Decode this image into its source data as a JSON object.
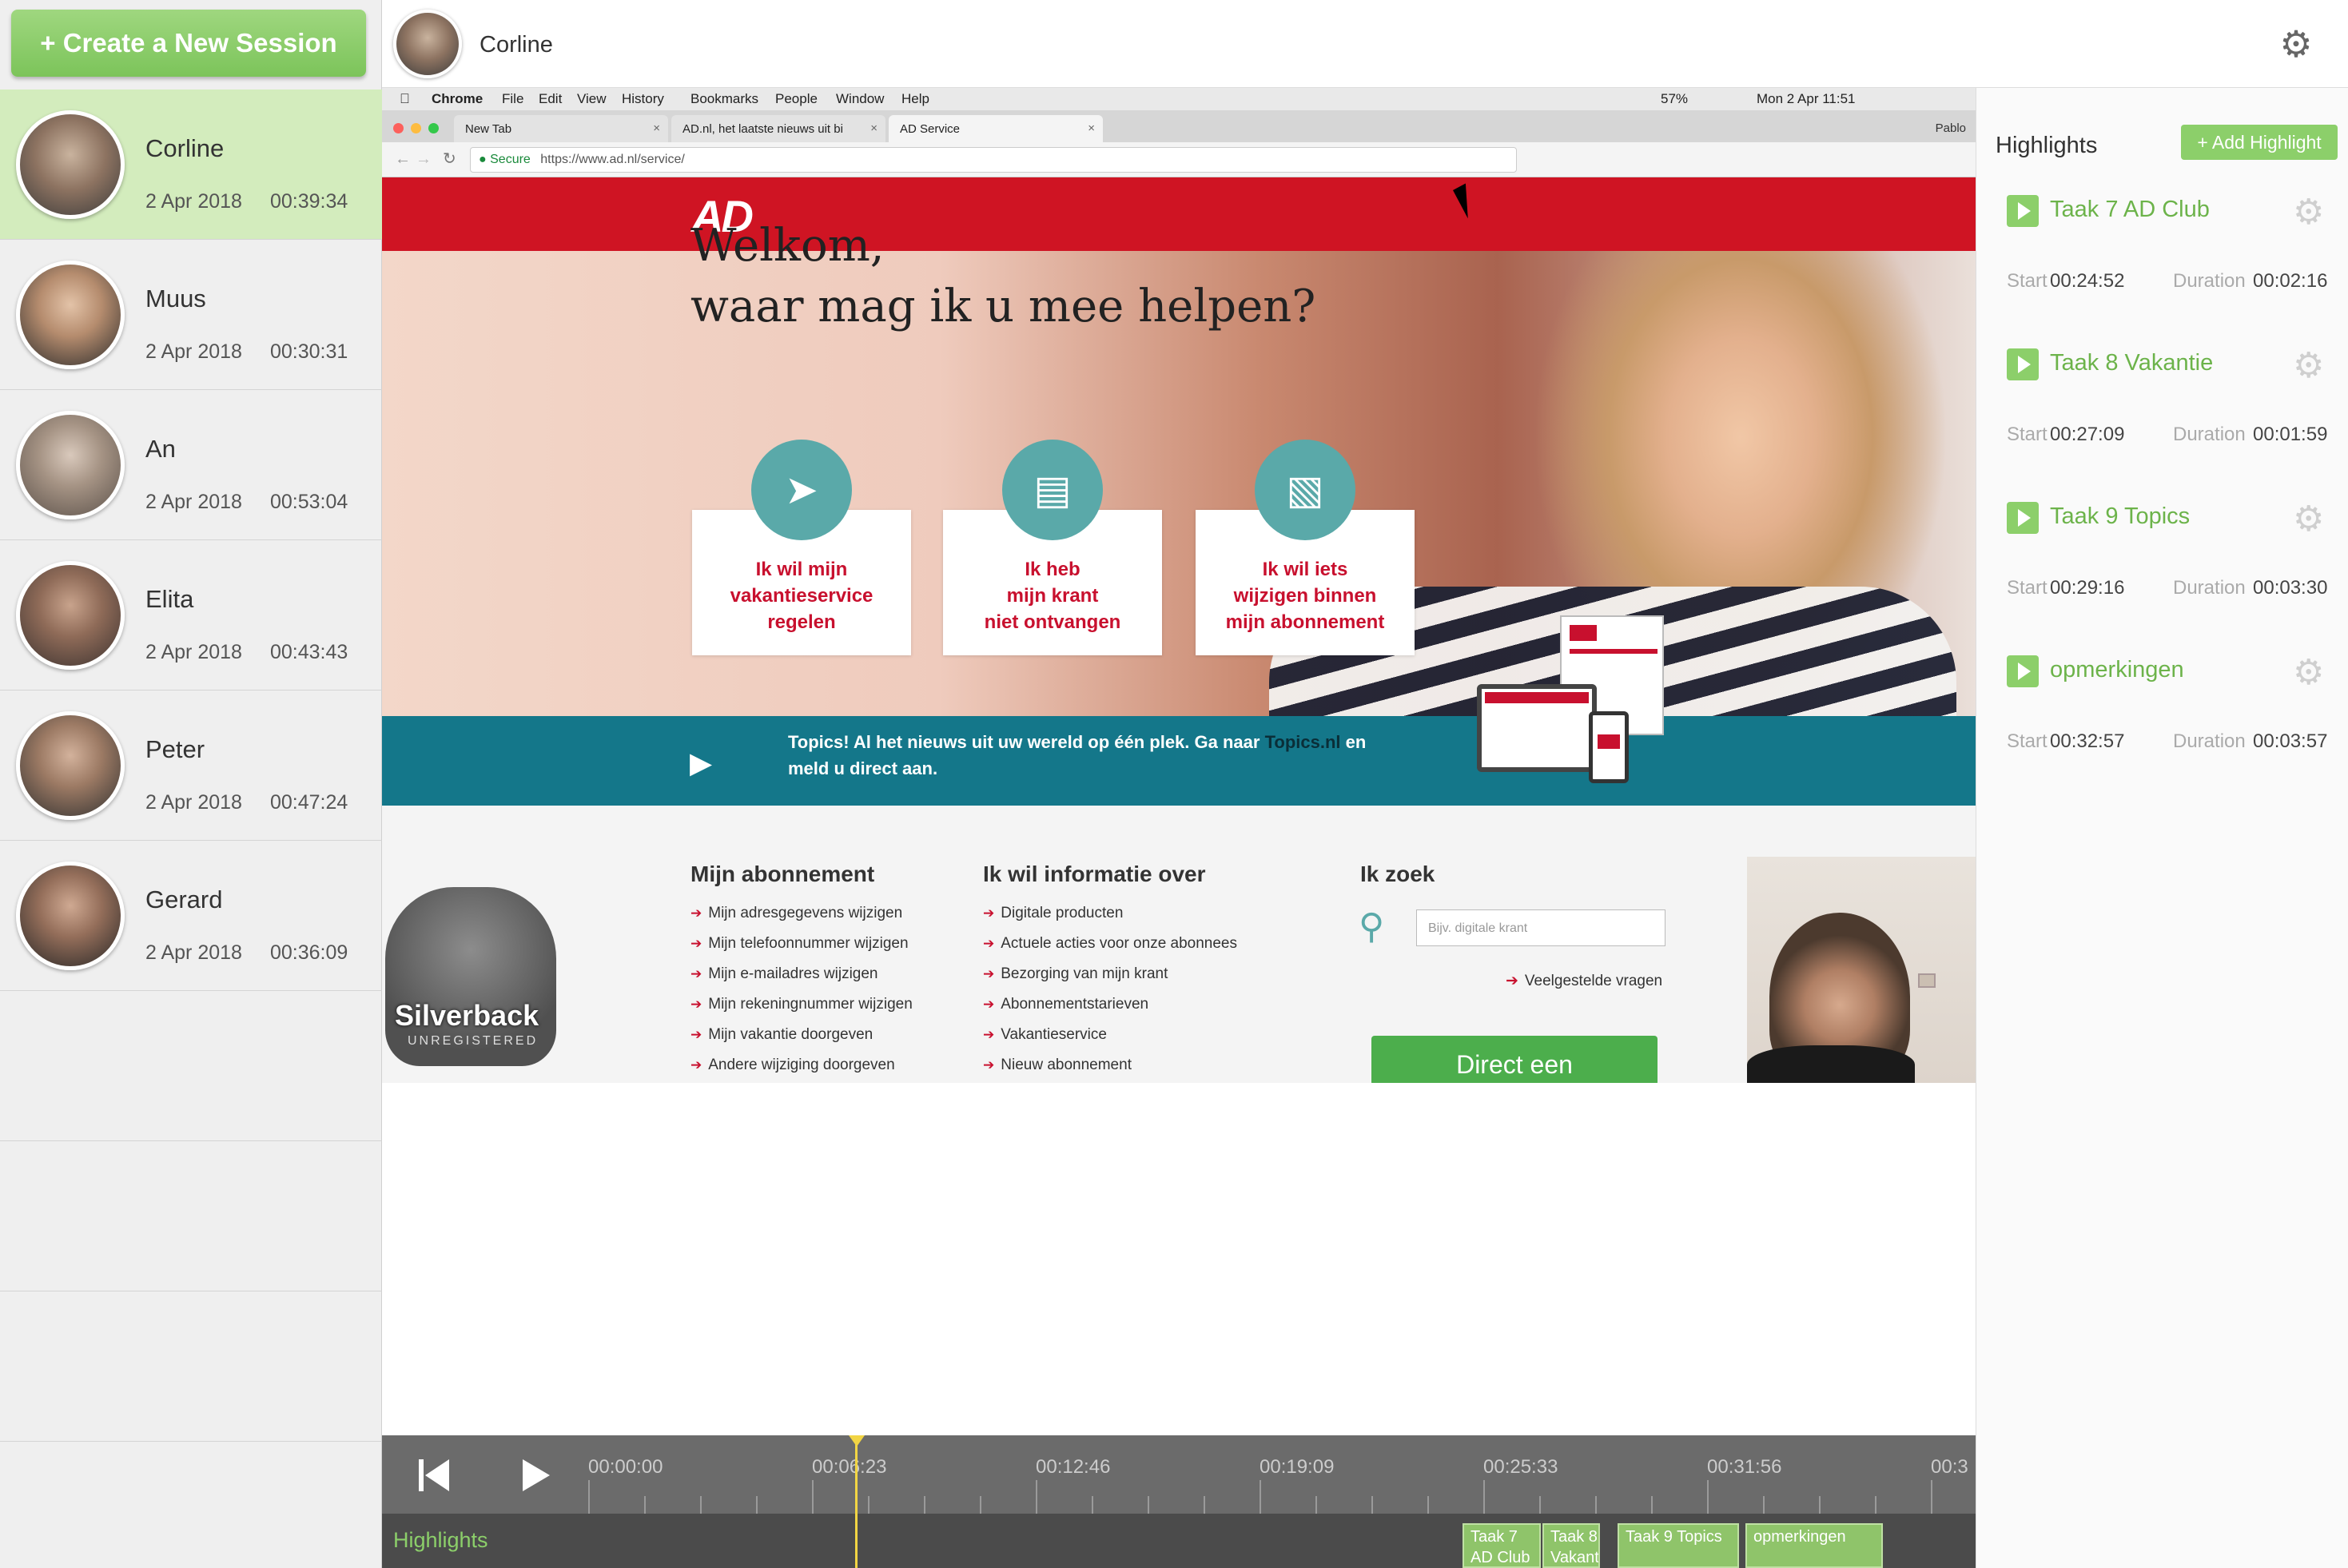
{
  "sidebar": {
    "create_label": "+ Create a New Session",
    "sessions": [
      {
        "name": "Corline",
        "date": "2 Apr 2018",
        "duration": "00:39:34",
        "active": true
      },
      {
        "name": "Muus",
        "date": "2 Apr 2018",
        "duration": "00:30:31"
      },
      {
        "name": "An",
        "date": "2 Apr 2018",
        "duration": "00:53:04"
      },
      {
        "name": "Elita",
        "date": "2 Apr 2018",
        "duration": "00:43:43"
      },
      {
        "name": "Peter",
        "date": "2 Apr 2018",
        "duration": "00:47:24"
      },
      {
        "name": "Gerard",
        "date": "2 Apr 2018",
        "duration": "00:36:09"
      }
    ]
  },
  "header": {
    "session_name": "Corline",
    "settings_icon": "gear-icon"
  },
  "highlights_panel": {
    "title": "Highlights",
    "add_label": "+ Add Highlight",
    "start_label": "Start",
    "duration_label": "Duration",
    "items": [
      {
        "name": "Taak 7 AD Club",
        "start": "00:24:52",
        "duration": "00:02:16"
      },
      {
        "name": "Taak 8 Vakantie",
        "start": "00:27:09",
        "duration": "00:01:59"
      },
      {
        "name": "Taak 9 Topics",
        "start": "00:29:16",
        "duration": "00:03:30"
      },
      {
        "name": "opmerkingen",
        "start": "00:32:57",
        "duration": "00:03:57"
      }
    ]
  },
  "recording": {
    "menubar": {
      "app": "Chrome",
      "menus": [
        "File",
        "Edit",
        "View",
        "History",
        "Bookmarks",
        "People",
        "Window",
        "Help"
      ],
      "battery": "57%",
      "clock": "Mon 2 Apr  11:51"
    },
    "tabs": [
      "New Tab",
      "AD.nl, het laatste nieuws uit bi",
      "AD Service"
    ],
    "profile": "Pablo",
    "secure_label": "Secure",
    "url": "https://www.ad.nl/service/",
    "logo": "AD",
    "welcome_line1": "Welkom,",
    "welcome_line2": "waar mag ik u mee helpen?",
    "cards": [
      {
        "l1": "Ik wil mijn",
        "l2": "vakantieservice",
        "l3": "regelen"
      },
      {
        "l1": "Ik heb",
        "l2": "mijn krant",
        "l3": "niet ontvangen"
      },
      {
        "l1": "Ik wil iets",
        "l2": "wijzigen binnen",
        "l3": "mijn abonnement"
      }
    ],
    "topics_text": "Topics! Al het nieuws uit uw wereld op één plek. Ga naar",
    "topics_link": "Topics.nl",
    "topics_text2": "en meld u direct aan.",
    "col1_title": "Mijn abonnement",
    "col1_links": [
      "Mijn adresgegevens wijzigen",
      "Mijn telefoonnummer wijzigen",
      "Mijn e-mailadres wijzigen",
      "Mijn rekeningnummer wijzigen",
      "Mijn vakantie doorgeven",
      "Andere wijziging doorgeven"
    ],
    "col2_title": "Ik wil informatie over",
    "col2_links": [
      "Digitale producten",
      "Actuele acties voor onze abonnees",
      "Bezorging van mijn krant",
      "Abonnementstarieven",
      "Vakantieservice",
      "Nieuw abonnement"
    ],
    "col3_title": "Ik zoek",
    "search_placeholder": "Bijv. digitale krant",
    "faq_link": "Veelgestelde vragen",
    "direct_button": "Direct een",
    "watermark": "Silverback",
    "watermark_sub": "UNREGISTERED"
  },
  "timeline": {
    "labels": [
      "00:00:00",
      "00:06:23",
      "00:12:46",
      "00:19:09",
      "00:25:33",
      "00:31:56",
      "00:3"
    ],
    "highlights_label": "Highlights",
    "segments": [
      {
        "l1": "Taak 7",
        "l2": "AD Club"
      },
      {
        "l1": "Taak 8",
        "l2": "Vakant"
      },
      {
        "l1": "Taak 9 Topics",
        "l2": ""
      },
      {
        "l1": "opmerkingen",
        "l2": ""
      }
    ],
    "playhead_time": "00:07:07"
  },
  "colors": {
    "accent_green": "#8ccf6a",
    "ad_red": "#cf1423",
    "teal": "#14778a"
  }
}
